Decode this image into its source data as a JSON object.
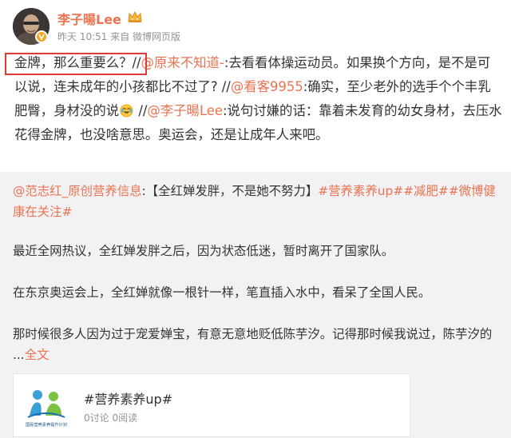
{
  "author": {
    "name": "李子暘Lee",
    "time": "昨天 10:51",
    "source": "来自 微博网页版"
  },
  "post": {
    "segments": [
      {
        "text": "金牌，那么重要么？//",
        "style": "plain"
      },
      {
        "text": "@原来不知道-",
        "style": "mention"
      },
      {
        "text": ":去看看体操运动员。如果换个方向，是不是可以说，连未成年的小孩都比不过了? //",
        "style": "plain"
      },
      {
        "text": "@看客9955",
        "style": "mention"
      },
      {
        "text": ":确实，至少老外的选手个个丰乳肥臀，身材没的说",
        "style": "plain"
      },
      {
        "text": " //",
        "style": "plain"
      },
      {
        "text": "@李子暘Lee",
        "style": "mention"
      },
      {
        "text": ":说句讨嫌的话：靠着未发育的幼女身材，去压水花得金牌，也没啥意思。奥运会，还是让成年人来吧。",
        "style": "plain"
      }
    ]
  },
  "repost": {
    "author_mention": "@范志红_原创营养信息",
    "intro": ":【全红婵发胖，不是她不努力】",
    "tags": [
      "#营养素养up#",
      "#减肥#",
      "#微博健康在关注#"
    ],
    "paragraph1": "最近全网热议，全红婵发胖之后，因为状态低迷，暂时离开了国家队。",
    "paragraph2": "在东京奥运会上，全红婵就像一根针一样，笔直插入水中，看呆了全国人民。",
    "paragraph3": "那时候很多人因为过于宠爱婵宝，有意无意地贬低陈芋汐。记得那时候我说过，陈芋汐的 ...",
    "full_text_link": "全文"
  },
  "topic_card": {
    "title": "#营养素养up#",
    "stats": "0讨论 0阅读",
    "thumb_caption": "国民营养素养提升计划"
  },
  "colors": {
    "accent": "#eb7350",
    "meta": "#939393",
    "repost_bg": "#f2f2f5",
    "highlight": "#e53935"
  }
}
